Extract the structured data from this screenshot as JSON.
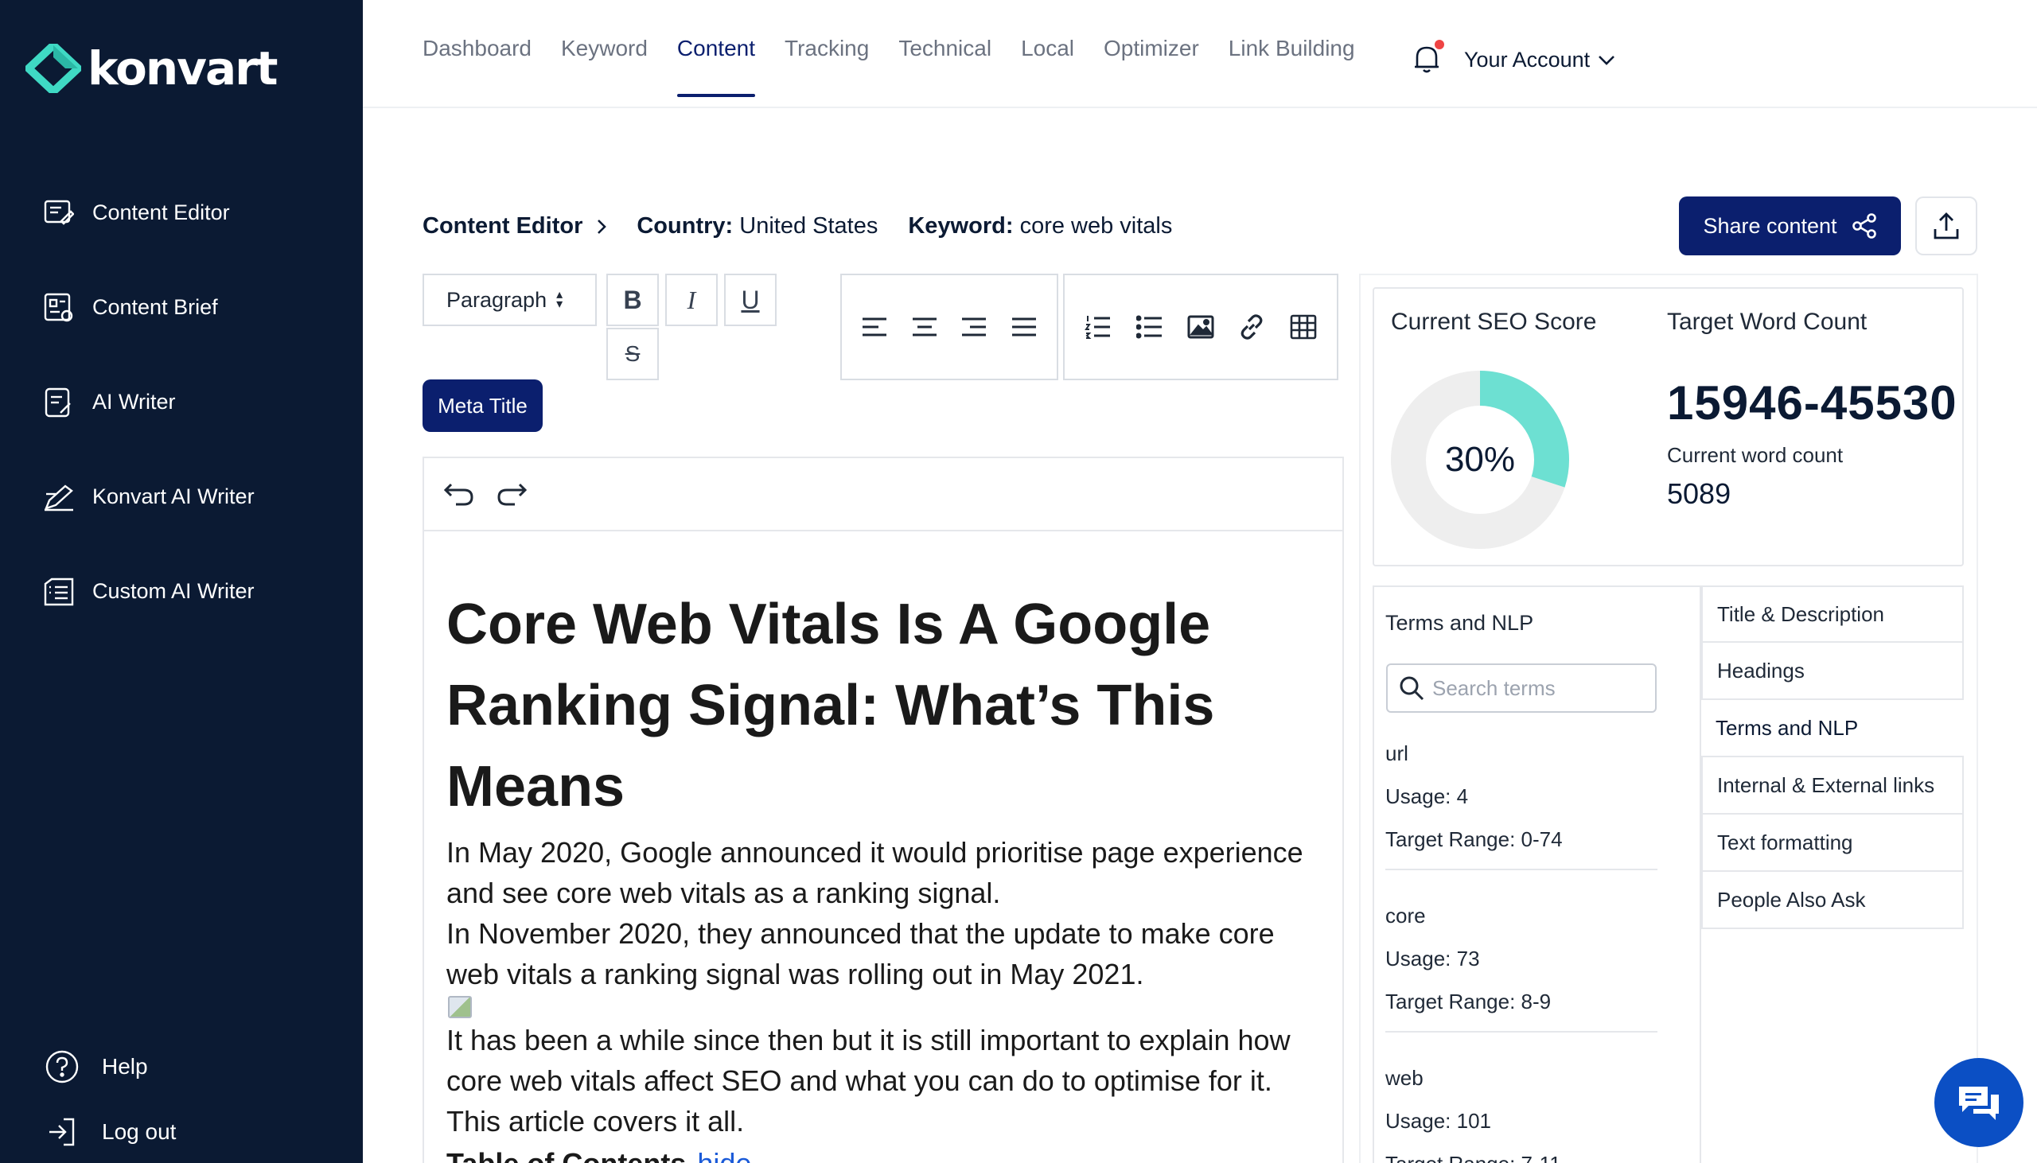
{
  "brand": {
    "name": "konvart",
    "accent": "#3fd9c4",
    "primary": "#0b1f6e",
    "sidebar_bg": "#0b1a33"
  },
  "sidebar": {
    "items": [
      {
        "label": "Content Editor",
        "icon": "content-editor-icon"
      },
      {
        "label": "Content Brief",
        "icon": "content-brief-icon"
      },
      {
        "label": "AI Writer",
        "icon": "ai-writer-icon"
      },
      {
        "label": "Konvart AI Writer",
        "icon": "pen-icon"
      },
      {
        "label": "Custom AI Writer",
        "icon": "custom-writer-icon"
      }
    ],
    "bottom": [
      {
        "label": "Help",
        "icon": "help-icon"
      },
      {
        "label": "Log out",
        "icon": "logout-icon"
      }
    ]
  },
  "topnav": {
    "tabs": [
      "Dashboard",
      "Keyword",
      "Content",
      "Tracking",
      "Technical",
      "Local",
      "Optimizer",
      "Link Building"
    ],
    "active": "Content",
    "account": "Your Account"
  },
  "breadcrumb": {
    "page": "Content Editor",
    "country_label": "Country:",
    "country": "United States",
    "keyword_label": "Keyword:",
    "keyword": "core web vitals"
  },
  "actions": {
    "share": "Share content"
  },
  "toolbar": {
    "paragraph": "Paragraph",
    "bold": "B",
    "italic": "I",
    "underline": "U",
    "strike": "S",
    "meta_title": "Meta Title"
  },
  "editor": {
    "heading": "Core Web Vitals Is A Google Ranking Signal: What’s This Means",
    "p1": "In May 2020, Google announced it would prioritise page experience and see core web vitals as a ranking signal.",
    "p2": "In November 2020, they announced that the update to make core web vitals a ranking signal was rolling out in May 2021.",
    "p3": "It has been a while since then but it is still important to explain how core web vitals affect SEO and what you can do to optimise for it.",
    "p4": "This article covers it all.",
    "toc": "Table of Contents",
    "toc_link": "hide"
  },
  "score": {
    "seo_label": "Current SEO Score",
    "seo_value": "30%",
    "seo_fraction": 0.3,
    "target_label": "Target Word Count",
    "target_range": "15946-45530",
    "current_label": "Current word count",
    "current_value": "5089"
  },
  "terms": {
    "title": "Terms and NLP",
    "search_placeholder": "Search terms",
    "items": [
      {
        "term": "url",
        "usage": "Usage: 4",
        "range": "Target Range: 0-74"
      },
      {
        "term": "core",
        "usage": "Usage: 73",
        "range": "Target Range: 8-9"
      },
      {
        "term": "web",
        "usage": "Usage: 101",
        "range": "Target Range: 7-11"
      }
    ]
  },
  "panel_tabs": [
    "Title & Description",
    "Headings",
    "Terms and NLP",
    "Internal & External links",
    "Text formatting",
    "People Also Ask"
  ]
}
